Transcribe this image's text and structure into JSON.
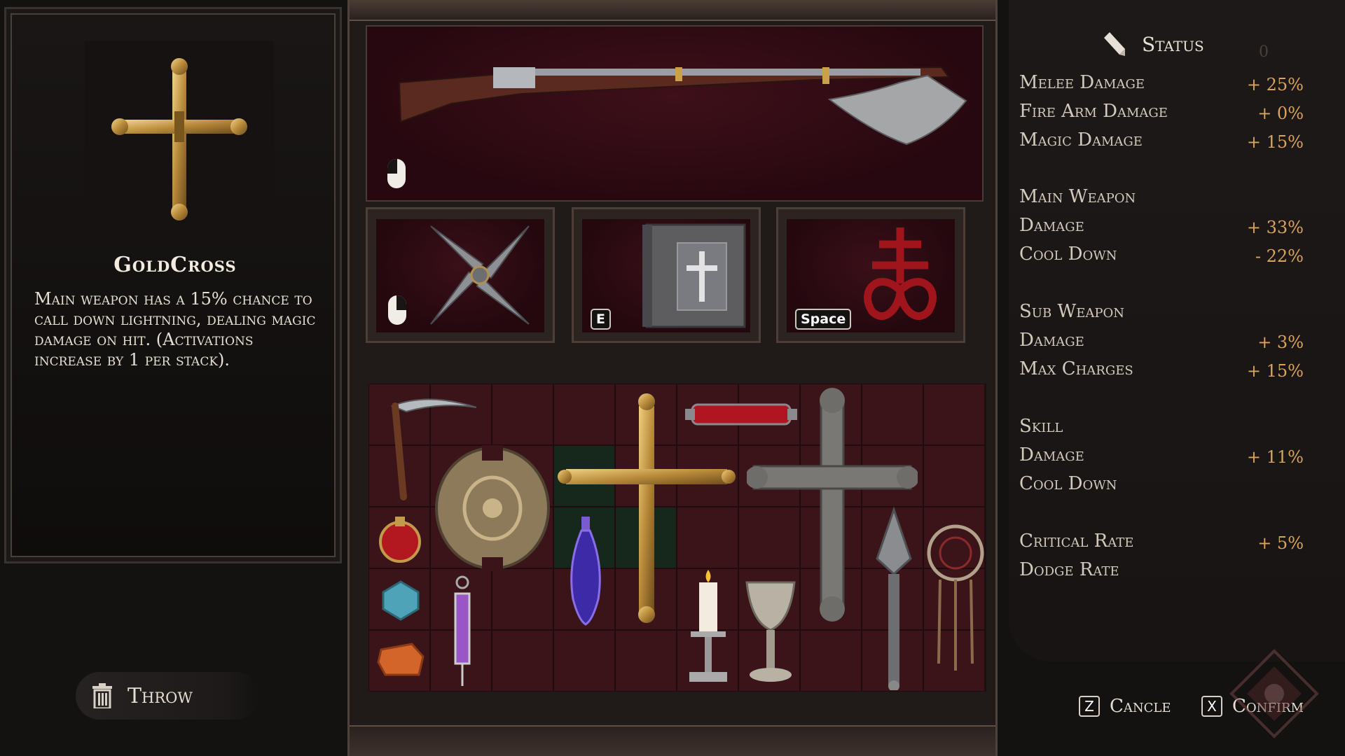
{
  "selected_item": {
    "name": "GoldCross",
    "description": "Main weapon has a 15% chance to call down lightning, dealing magic damage on hit. (Activations increase by 1 per stack)."
  },
  "actions": {
    "throw_label": "Throw",
    "cancel_key": "Z",
    "cancel_label": "Cancle",
    "confirm_key": "X",
    "confirm_label": "Confirm"
  },
  "equipment": {
    "main_weapon": {
      "name": "musket-axe",
      "binding_icon": "mouse-left-icon"
    },
    "sub_slots": [
      {
        "name": "shuriken",
        "binding_icon": "mouse-right-icon",
        "key": ""
      },
      {
        "name": "holy-book",
        "binding_icon": "",
        "key": "E"
      },
      {
        "name": "leviathan-cross-sigil",
        "binding_icon": "",
        "key": "Space"
      }
    ]
  },
  "inventory": {
    "items": [
      "scythe",
      "golden-shield",
      "red-orb",
      "blue-gem",
      "amber-crystal",
      "syringe",
      "purple-potion",
      "gold-cross",
      "blood-vial",
      "silver-cross",
      "candle",
      "chalice",
      "spear-talisman",
      "dreamcatcher"
    ]
  },
  "status": {
    "title": "Status",
    "counter": "0",
    "stats": [
      {
        "label": "Melee Damage",
        "value": "+ 25%"
      },
      {
        "label": "Fire Arm Damage",
        "value": "+ 0%"
      },
      {
        "label": "Magic Damage",
        "value": "+ 15%"
      },
      {
        "label": "Main Weapon",
        "value": ""
      },
      {
        "label": "Damage",
        "value": "+ 33%"
      },
      {
        "label": "Cool Down",
        "value": "- 22%"
      },
      {
        "label": "Sub Weapon",
        "value": ""
      },
      {
        "label": "Damage",
        "value": "+ 3%"
      },
      {
        "label": "Max Charges",
        "value": "+ 15%"
      },
      {
        "label": "Skill",
        "value": ""
      },
      {
        "label": "Damage",
        "value": "+ 11%"
      },
      {
        "label": "Cool Down",
        "value": ""
      },
      {
        "label": "Critical Rate",
        "value": "+ 5%"
      },
      {
        "label": "Dodge Rate",
        "value": ""
      }
    ]
  },
  "colors": {
    "accent_value": "#d9a35c",
    "slot_bg": "#3a1419",
    "highlight_cell": "#16281c"
  }
}
